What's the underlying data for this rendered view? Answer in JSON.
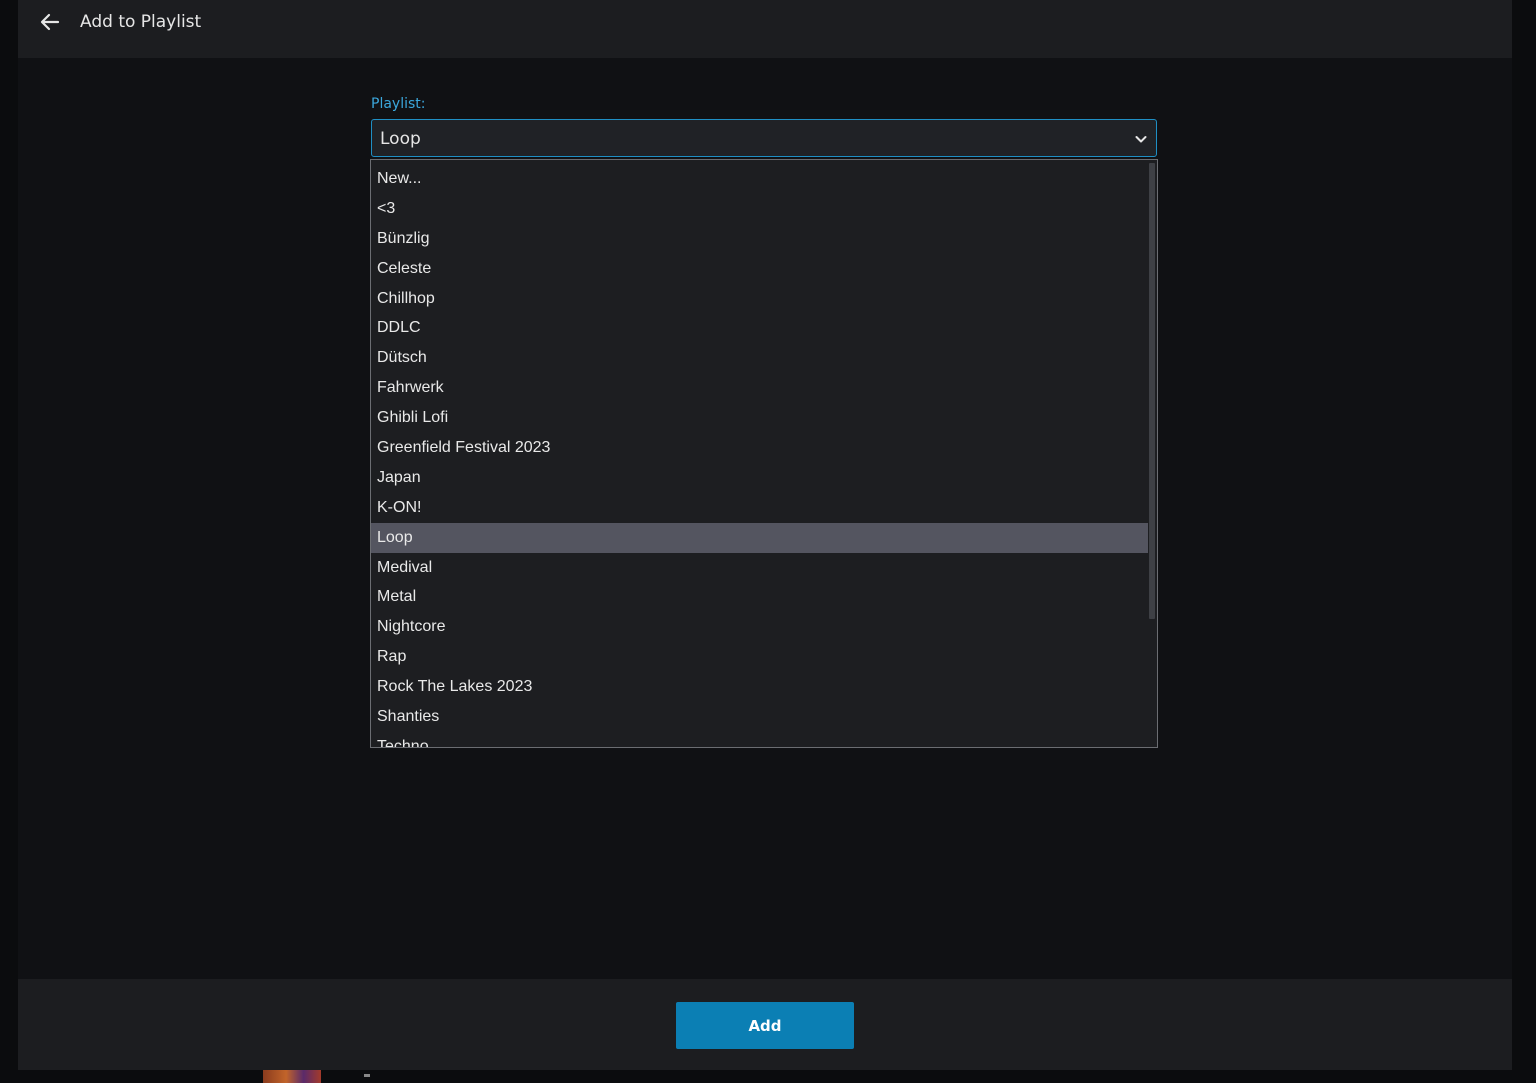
{
  "header": {
    "back_icon": "arrow-left-icon",
    "title": "Add to Playlist"
  },
  "playlist_field": {
    "label": "Playlist:",
    "selected_value": "Loop",
    "chevron_icon": "chevron-down-icon",
    "options": [
      "New...",
      "<3",
      "Bünzlig",
      "Celeste",
      "Chillhop",
      "DDLC",
      "Dütsch",
      "Fahrwerk",
      "Ghibli Lofi",
      "Greenfield Festival 2023",
      "Japan",
      "K-ON!",
      "Loop",
      "Medival",
      "Metal",
      "Nightcore",
      "Rap",
      "Rock The Lakes 2023",
      "Shanties",
      "Techno"
    ]
  },
  "footer": {
    "add_label": "Add"
  },
  "colors": {
    "accent": "#0b7fb4",
    "label_blue": "#3ba7dc",
    "selected_option": "#545560"
  }
}
